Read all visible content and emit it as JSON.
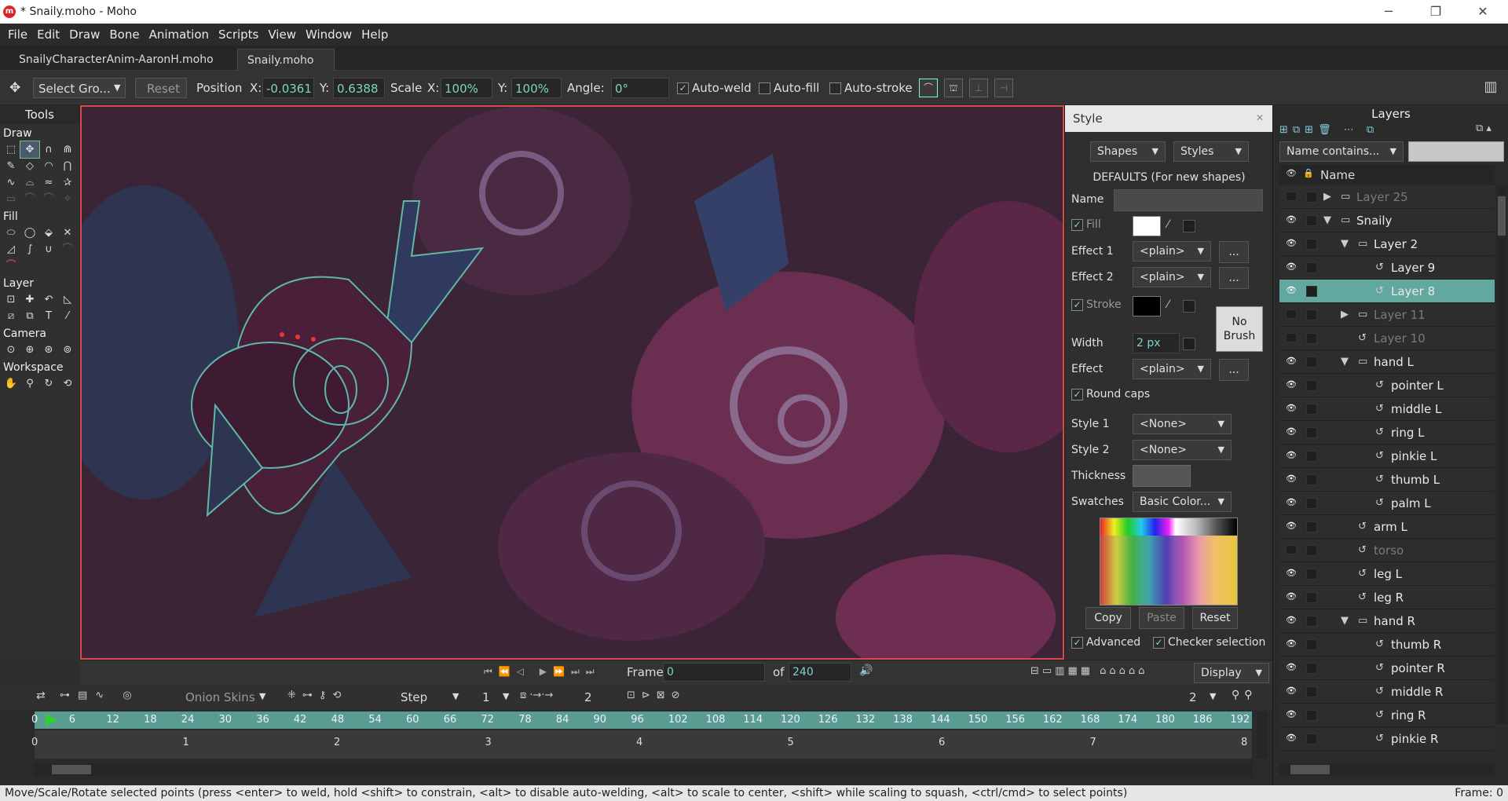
{
  "window": {
    "title": "* Snaily.moho - Moho",
    "logo": "m"
  },
  "menu": [
    "File",
    "Edit",
    "Draw",
    "Bone",
    "Animation",
    "Scripts",
    "View",
    "Window",
    "Help"
  ],
  "tabs": [
    "SnailyCharacterAnim-AaronH.moho",
    "Snaily.moho"
  ],
  "options": {
    "tool_select": "Select Gro...",
    "reset": "Reset",
    "position_label": "Position",
    "x_label": "X:",
    "x_value": "-0.0361",
    "y_label": "Y:",
    "y_value": "0.6388",
    "scale_label": "Scale",
    "sx_label": "X:",
    "sx_value": "100%",
    "sy_label": "Y:",
    "sy_value": "100%",
    "angle_label": "Angle:",
    "angle_value": "0°",
    "auto_weld": "Auto-weld",
    "auto_fill": "Auto-fill",
    "auto_stroke": "Auto-stroke"
  },
  "tools": {
    "title": "Tools",
    "sections": {
      "draw": "Draw",
      "fill": "Fill",
      "layer": "Layer",
      "camera": "Camera",
      "workspace": "Workspace"
    }
  },
  "style": {
    "title": "Style",
    "shapes": "Shapes",
    "styles": "Styles",
    "defaults": "DEFAULTS (For new shapes)",
    "name_label": "Name",
    "name_value": "",
    "fill_label": "Fill",
    "fill_color": "#ffffff",
    "effect1_label": "Effect 1",
    "effect1": "<plain>",
    "effect2_label": "Effect 2",
    "effect2": "<plain>",
    "stroke_label": "Stroke",
    "stroke_color": "#000000",
    "no_brush": "No Brush",
    "width_label": "Width",
    "width_value": "2 px",
    "effect_label": "Effect",
    "effect": "<plain>",
    "round_caps": "Round caps",
    "style1_label": "Style 1",
    "style1": "<None>",
    "style2_label": "Style 2",
    "style2": "<None>",
    "thickness_label": "Thickness",
    "swatches_label": "Swatches",
    "swatches": "Basic Color...",
    "copy": "Copy",
    "paste": "Paste",
    "reset": "Reset",
    "advanced": "Advanced",
    "checker": "Checker selection",
    "more": "..."
  },
  "layers": {
    "title": "Layers",
    "filter": "Name contains...",
    "name_col": "Name",
    "rows": [
      {
        "name": "Layer 25",
        "indent": 0,
        "type": "group-collapsed",
        "dim": true
      },
      {
        "name": "Snaily",
        "indent": 0,
        "type": "group-open",
        "dim": false
      },
      {
        "name": "Layer 2",
        "indent": 1,
        "type": "group-open",
        "dim": false
      },
      {
        "name": "Layer 9",
        "indent": 2,
        "type": "vector",
        "dim": false
      },
      {
        "name": "Layer 8",
        "indent": 2,
        "type": "vector",
        "dim": false,
        "selected": true
      },
      {
        "name": "Layer 11",
        "indent": 1,
        "type": "group-collapsed",
        "dim": true
      },
      {
        "name": "Layer 10",
        "indent": 1,
        "type": "vector",
        "dim": true
      },
      {
        "name": "hand L",
        "indent": 1,
        "type": "group-open",
        "dim": false
      },
      {
        "name": "pointer L",
        "indent": 2,
        "type": "vector",
        "dim": false
      },
      {
        "name": "middle L",
        "indent": 2,
        "type": "vector",
        "dim": false
      },
      {
        "name": "ring L",
        "indent": 2,
        "type": "vector",
        "dim": false
      },
      {
        "name": "pinkie L",
        "indent": 2,
        "type": "vector",
        "dim": false
      },
      {
        "name": "thumb L",
        "indent": 2,
        "type": "vector",
        "dim": false
      },
      {
        "name": "palm L",
        "indent": 2,
        "type": "vector",
        "dim": false
      },
      {
        "name": "arm L",
        "indent": 1,
        "type": "vector",
        "dim": false
      },
      {
        "name": "torso",
        "indent": 1,
        "type": "vector",
        "dim": true
      },
      {
        "name": "leg L",
        "indent": 1,
        "type": "vector",
        "dim": false
      },
      {
        "name": "leg R",
        "indent": 1,
        "type": "vector",
        "dim": false
      },
      {
        "name": "hand R",
        "indent": 1,
        "type": "group-open",
        "dim": false
      },
      {
        "name": "thumb R",
        "indent": 2,
        "type": "vector",
        "dim": false
      },
      {
        "name": "pointer R",
        "indent": 2,
        "type": "vector",
        "dim": false
      },
      {
        "name": "middle R",
        "indent": 2,
        "type": "vector",
        "dim": false
      },
      {
        "name": "ring R",
        "indent": 2,
        "type": "vector",
        "dim": false
      },
      {
        "name": "pinkie R",
        "indent": 2,
        "type": "vector",
        "dim": false
      }
    ]
  },
  "transport": {
    "frame_label": "Frame",
    "frame_value": "0",
    "of_label": "of",
    "of_value": "240",
    "display": "Display"
  },
  "timeline": {
    "onion": "Onion Skins",
    "step": "Step",
    "step_value": "1",
    "step_value2": "2",
    "zoom_value": "2",
    "ruler": [
      "0",
      "6",
      "12",
      "18",
      "24",
      "30",
      "36",
      "42",
      "48",
      "54",
      "60",
      "66",
      "72",
      "78",
      "84",
      "90",
      "96",
      "102",
      "108",
      "114",
      "120",
      "126",
      "132",
      "138",
      "144",
      "150",
      "156",
      "162",
      "168",
      "174",
      "180",
      "186",
      "192"
    ],
    "seconds": [
      "0",
      "1",
      "2",
      "3",
      "4",
      "5",
      "6",
      "7",
      "8"
    ]
  },
  "status": {
    "message": "Move/Scale/Rotate selected points (press <enter> to weld, hold <shift> to constrain, <alt> to disable auto-welding, <alt> to scale to center, <shift> while scaling to squash, <ctrl/cmd> to select points)",
    "frame": "Frame: 0"
  }
}
